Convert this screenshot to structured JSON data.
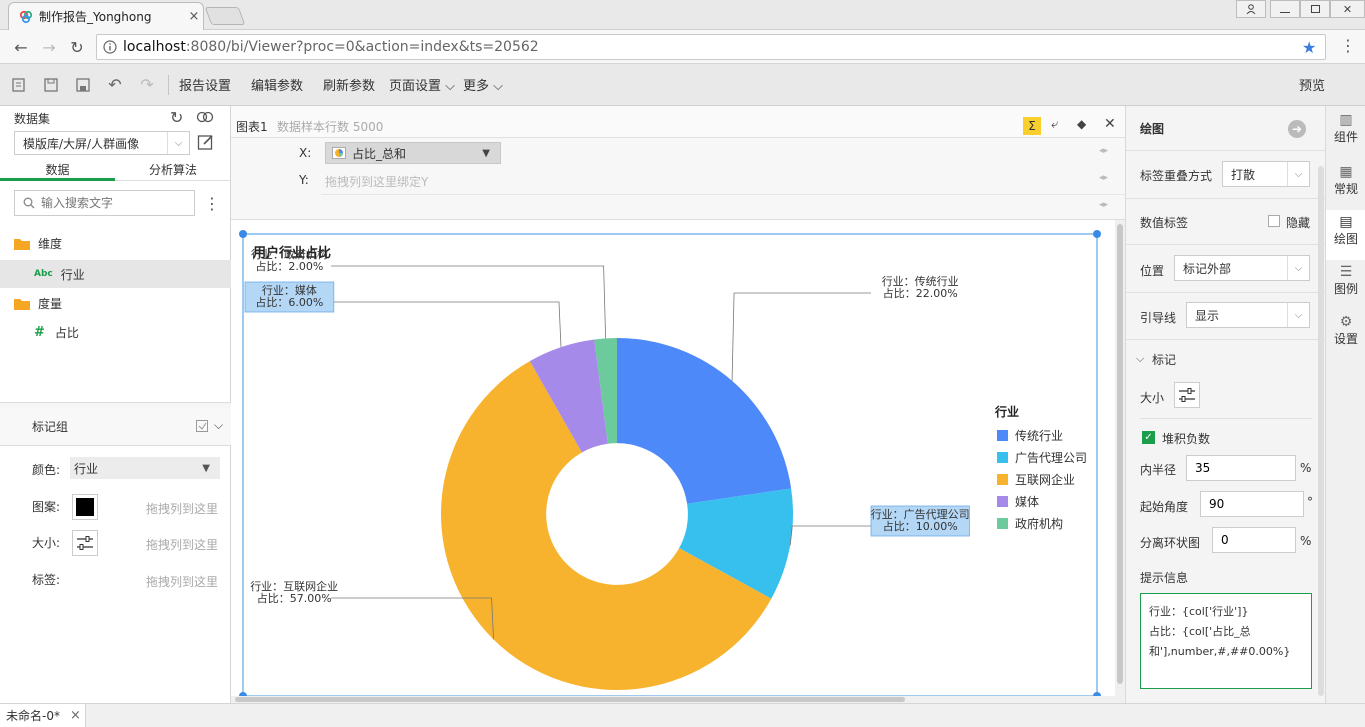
{
  "browser": {
    "tab_title": "制作报告_Yonghong",
    "tab_close": "×",
    "url_host": "localhost",
    "url_rest": ":8080/bi/Viewer?proc=0&action=index&ts=20562"
  },
  "toolbar": {
    "items": [
      "报告设置",
      "编辑参数",
      "刷新参数",
      "页面设置 ⌵",
      "更多 ⌵"
    ],
    "preview": "预览"
  },
  "left": {
    "dataset_label": "数据集",
    "dataset_value": "模版库/大屏/人群画像",
    "tabs": [
      "数据",
      "分析算法"
    ],
    "search_placeholder": "输入搜索文字",
    "dimension_folder": "维度",
    "dimension_items": [
      {
        "type": "Abc",
        "name": "行业"
      }
    ],
    "measure_folder": "度量",
    "measure_items": [
      {
        "type": "#",
        "name": "占比"
      }
    ],
    "mark_group": "标记组",
    "color_label": "颜色:",
    "color_value": "行业",
    "shape_label": "图案:",
    "size_label": "大小:",
    "tag_label": "标签:",
    "drop_hint": "拖拽列到这里"
  },
  "center": {
    "chart_tab": "图表1",
    "sample_rows": "数据样本行数 5000",
    "x_label": "X:",
    "x_value": "占比_总和",
    "y_label": "Y:",
    "y_placeholder": "拖拽列到这里绑定Y"
  },
  "chart_data": {
    "type": "pie",
    "title": "用户行业占比",
    "categories": [
      "传统行业",
      "广告代理公司",
      "互联网企业",
      "媒体",
      "政府机构"
    ],
    "values": [
      22,
      10,
      57,
      6,
      2
    ],
    "colors": [
      "#4d89f9",
      "#37c0ee",
      "#f7b32d",
      "#a68ae9",
      "#6cca9c"
    ],
    "labels": [
      {
        "line1": "行业：传统行业",
        "line2": "占比：22.00%"
      },
      {
        "line1": "行业：广告代理公司",
        "line2": "占比：10.00%"
      },
      {
        "line1": "行业：互联网企业",
        "line2": "占比：57.00%"
      },
      {
        "line1": "行业：媒体",
        "line2": "占比：6.00%"
      },
      {
        "line1": "行业：政府机构",
        "line2": "占比：2.00%"
      }
    ],
    "legend_title": "行业",
    "legend_position": "right",
    "inner_radius_percent": 35,
    "start_angle": 90
  },
  "right": {
    "section_title": "绘图",
    "overlap_label": "标签重叠方式",
    "overlap_value": "打散",
    "value_label_title": "数值标签",
    "hide_label": "隐藏",
    "position_label": "位置",
    "position_value": "标记外部",
    "leader_label": "引导线",
    "leader_value": "显示",
    "mark_section": "标记",
    "size_label": "大小",
    "stack_label": "堆积负数",
    "inner_radius_label": "内半径",
    "inner_radius_value": "35",
    "start_angle_label": "起始角度",
    "start_angle_value": "90",
    "explode_label": "分离环状图",
    "explode_value": "0",
    "percent_unit": "%",
    "degree_unit": "°",
    "tooltip_label": "提示信息",
    "tooltip_line1": "行业：{col['行业']}",
    "tooltip_line2": "占比：{col['占比_总",
    "tooltip_line3": "和'],number,#,##0.00%}"
  },
  "rnav": [
    "组件",
    "常规",
    "绘图",
    "图例",
    "设置"
  ],
  "status": {
    "sheet": "未命名-0*",
    "close": "×"
  },
  "colors": {
    "accent": "#1a9e4c",
    "selection": "#b3d7f5",
    "selection_border": "#6aaee8"
  }
}
